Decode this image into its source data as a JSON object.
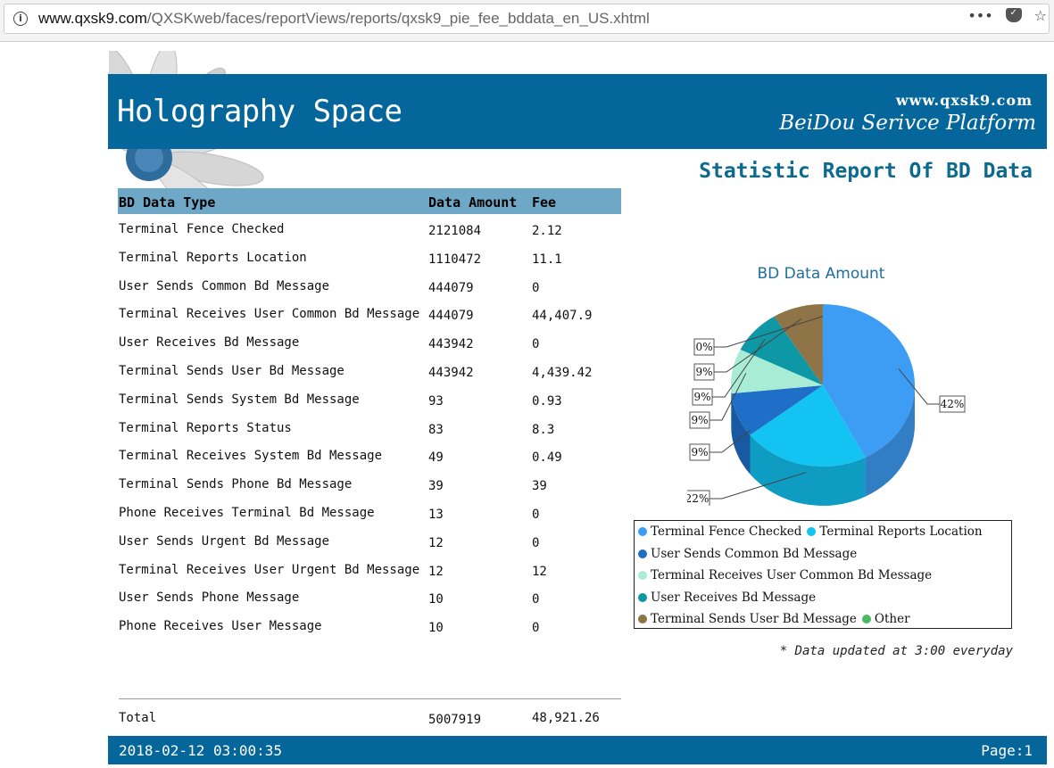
{
  "browser": {
    "url_host": "www.qxsk9.com",
    "url_path": "/QXSKweb/faces/reportViews/reports/qxsk9_pie_fee_bddata_en_US.xhtml",
    "more_label": "•••"
  },
  "header": {
    "brand": "Holography Space",
    "site": "www.qxsk9.com",
    "platform": "BeiDou Serivce Platform"
  },
  "report_title": "Statistic Report Of BD Data",
  "table": {
    "columns": [
      "BD Data Type",
      "Data Amount",
      "Fee"
    ],
    "rows": [
      [
        "Terminal Fence Checked",
        "2121084",
        "2.12"
      ],
      [
        "Terminal Reports Location",
        "1110472",
        "11.1"
      ],
      [
        "User Sends Common Bd Message",
        "444079",
        "0"
      ],
      [
        "Terminal Receives User Common Bd Message",
        "444079",
        "44,407.9"
      ],
      [
        "User Receives Bd Message",
        "443942",
        "0"
      ],
      [
        "Terminal Sends User Bd Message",
        "443942",
        "4,439.42"
      ],
      [
        "Terminal Sends System Bd Message",
        "93",
        "0.93"
      ],
      [
        "Terminal Reports Status",
        "83",
        "8.3"
      ],
      [
        "Terminal Receives System Bd Message",
        "49",
        "0.49"
      ],
      [
        "Terminal Sends Phone Bd Message",
        "39",
        "39"
      ],
      [
        "Phone Receives Terminal Bd Message",
        "13",
        "0"
      ],
      [
        "User Sends Urgent Bd Message",
        "12",
        "0"
      ],
      [
        "Terminal Receives User Urgent Bd Message",
        "12",
        "12"
      ],
      [
        "User Sends Phone Message",
        "10",
        "0"
      ],
      [
        "Phone Receives User Message",
        "10",
        "0"
      ]
    ],
    "total": [
      "Total",
      "5007919",
      "48,921.26"
    ]
  },
  "footer": {
    "timestamp": "2018-02-12 03:00:35",
    "page": "Page:1"
  },
  "chart_data": {
    "type": "pie",
    "title": "BD Data Amount",
    "slices": [
      {
        "name": "Terminal Fence Checked",
        "value": 2121084,
        "label": "42%",
        "color": "#3d9df5"
      },
      {
        "name": "Terminal Reports Location",
        "value": 1110472,
        "label": "22%",
        "color": "#13c3f2"
      },
      {
        "name": "User Sends Common Bd Message",
        "value": 444079,
        "label": "9%",
        "color": "#1f6fc9"
      },
      {
        "name": "Terminal Receives User Common Bd Message",
        "value": 444079,
        "label": "9%",
        "color": "#a9ecd6"
      },
      {
        "name": "User Receives Bd Message",
        "value": 443942,
        "label": "9%",
        "color": "#0e97a5"
      },
      {
        "name": "Terminal Sends User Bd Message",
        "value": 443942,
        "label": "9%",
        "color": "#8f7447"
      },
      {
        "name": "Other",
        "value": 321,
        "label": "0%",
        "color": "#4cb860"
      }
    ],
    "legend_placement": "bottom"
  },
  "note": "* Data updated at 3:00 everyday"
}
